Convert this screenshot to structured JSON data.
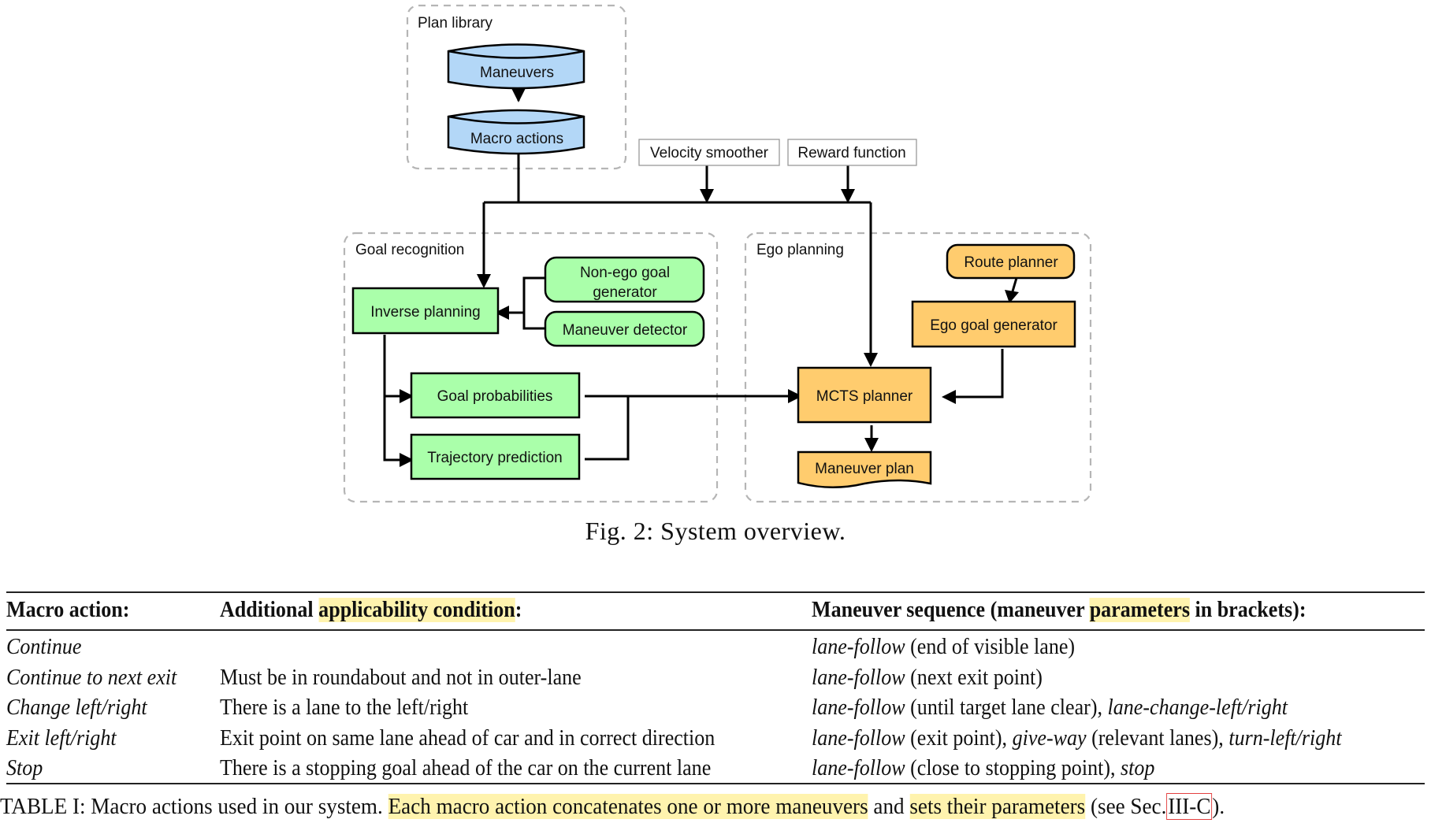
{
  "figure": {
    "groups": {
      "plan_library": "Plan library",
      "goal_recognition": "Goal recognition",
      "ego_planning": "Ego planning"
    },
    "nodes": {
      "maneuvers": "Maneuvers",
      "macro_actions": "Macro actions",
      "velocity_smoother": "Velocity smoother",
      "reward_function": "Reward function",
      "inverse_planning": "Inverse planning",
      "non_ego_goal_generator_line1": "Non-ego goal",
      "non_ego_goal_generator_line2": "generator",
      "maneuver_detector": "Maneuver detector",
      "goal_probabilities": "Goal probabilities",
      "trajectory_prediction": "Trajectory prediction",
      "route_planner": "Route planner",
      "ego_goal_generator": "Ego goal generator",
      "mcts_planner": "MCTS planner",
      "maneuver_plan": "Maneuver plan"
    },
    "colors": {
      "plan_library_fill": "#b3d7f7",
      "goal_recognition_fill": "#aaffaa",
      "ego_planning_fill": "#ffcc6e",
      "group_border": "#b5b5b5",
      "highlight": "#fff3ae",
      "reference_box": "#e34040"
    },
    "caption": "Fig. 2: System overview."
  },
  "table": {
    "headers": {
      "macro_action": "Macro action:",
      "condition_pre": "Additional ",
      "condition_hl": "applicability condition",
      "condition_post": ":",
      "sequence_pre": "Maneuver sequence (maneuver ",
      "sequence_hl": "parameters",
      "sequence_post": " in brackets):"
    },
    "rows": [
      {
        "macro_action": "Continue",
        "condition": "",
        "sequence": [
          {
            "text": "lane-follow",
            "italic": true
          },
          {
            "text": " (end of visible lane)",
            "italic": false
          }
        ]
      },
      {
        "macro_action": "Continue to next exit",
        "condition": "Must be in roundabout and not in outer-lane",
        "sequence": [
          {
            "text": "lane-follow",
            "italic": true
          },
          {
            "text": " (next exit point)",
            "italic": false
          }
        ]
      },
      {
        "macro_action": "Change left/right",
        "condition": "There is a lane to the left/right",
        "sequence": [
          {
            "text": "lane-follow",
            "italic": true
          },
          {
            "text": " (until target lane clear), ",
            "italic": false
          },
          {
            "text": "lane-change-left/right",
            "italic": true
          }
        ]
      },
      {
        "macro_action": "Exit left/right",
        "condition": "Exit point on same lane ahead of car and in correct direction",
        "sequence": [
          {
            "text": "lane-follow",
            "italic": true
          },
          {
            "text": " (exit point), ",
            "italic": false
          },
          {
            "text": "give-way",
            "italic": true
          },
          {
            "text": " (relevant lanes), ",
            "italic": false
          },
          {
            "text": "turn-left/right",
            "italic": true
          }
        ]
      },
      {
        "macro_action": "Stop",
        "condition": "There is a stopping goal ahead of the car on the current lane",
        "sequence": [
          {
            "text": "lane-follow",
            "italic": true
          },
          {
            "text": " (close to stopping point), ",
            "italic": false
          },
          {
            "text": "stop",
            "italic": true
          }
        ]
      }
    ],
    "caption": {
      "prefix": "TABLE I: Macro actions used in our system. ",
      "hl1": "Each macro action concatenates one or more maneuvers",
      "mid": " and ",
      "hl2": "sets their parameters",
      "post": " (see Sec.",
      "ref": "III-C",
      "end": ")."
    }
  }
}
